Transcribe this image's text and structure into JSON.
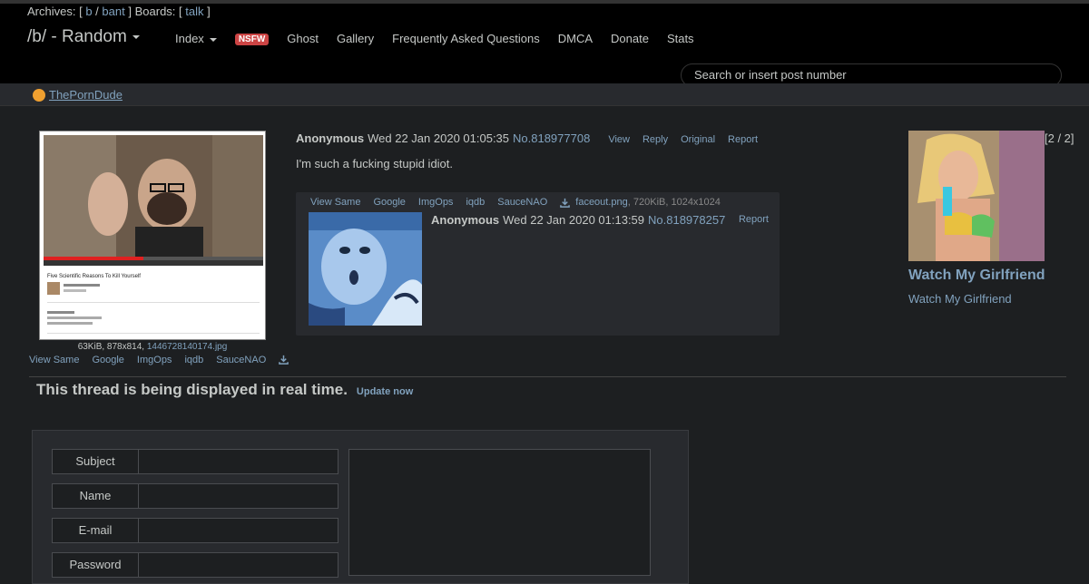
{
  "topbar": {
    "archives_label": "Archives: [",
    "archive_links": [
      "b",
      "bant"
    ],
    "archive_sep": "/",
    "archives_close": "]",
    "boards_label": "Boards: [",
    "board_links": [
      "talk"
    ],
    "boards_close": "]",
    "board_title": "/b/ - Random",
    "nav": {
      "index": "Index",
      "nsfw_badge": "NSFW",
      "ghost": "Ghost",
      "gallery": "Gallery",
      "faq": "Frequently Asked Questions",
      "dmca": "DMCA",
      "donate": "Donate",
      "stats": "Stats"
    },
    "search_placeholder": "Search or insert post number"
  },
  "sponsor": {
    "label": "ThePornDude"
  },
  "op": {
    "file_info_prefix": "63KiB, 878x814, ",
    "file_name": "1446728140174.jpg",
    "image_caption": "Five Scientific Reasons To Kill Yourself",
    "tools": [
      "View Same",
      "Google",
      "ImgOps",
      "iqdb",
      "SauceNAO"
    ],
    "name": "Anonymous",
    "datetime": "Wed 22 Jan 2020 01:05:35",
    "post_number": "No.818977708",
    "actions": [
      "View",
      "Reply",
      "Original",
      "Report"
    ],
    "body": "I'm such a fucking stupid idiot."
  },
  "reply": {
    "tools": [
      "View Same",
      "Google",
      "ImgOps",
      "iqdb",
      "SauceNAO"
    ],
    "file_name": "faceout.png",
    "file_info": ", 720KiB, 1024x1024",
    "name": "Anonymous",
    "datetime": "Wed 22 Jan 2020 01:13:59",
    "post_number": "No.818978257",
    "report": "Report"
  },
  "ad": {
    "count": "[2 / 2]",
    "title": "Watch My Girlfriend",
    "subtitle": "Watch My Girlfriend"
  },
  "realtime": {
    "message": "This thread is being displayed in real time.",
    "update_label": "Update now"
  },
  "form": {
    "subject_label": "Subject",
    "name_label": "Name",
    "email_label": "E-mail",
    "password_label": "Password"
  },
  "colors": {
    "background": "#1d1f21",
    "topbar": "#000000",
    "link": "#81a2be",
    "nsfw": "#cc4444"
  }
}
